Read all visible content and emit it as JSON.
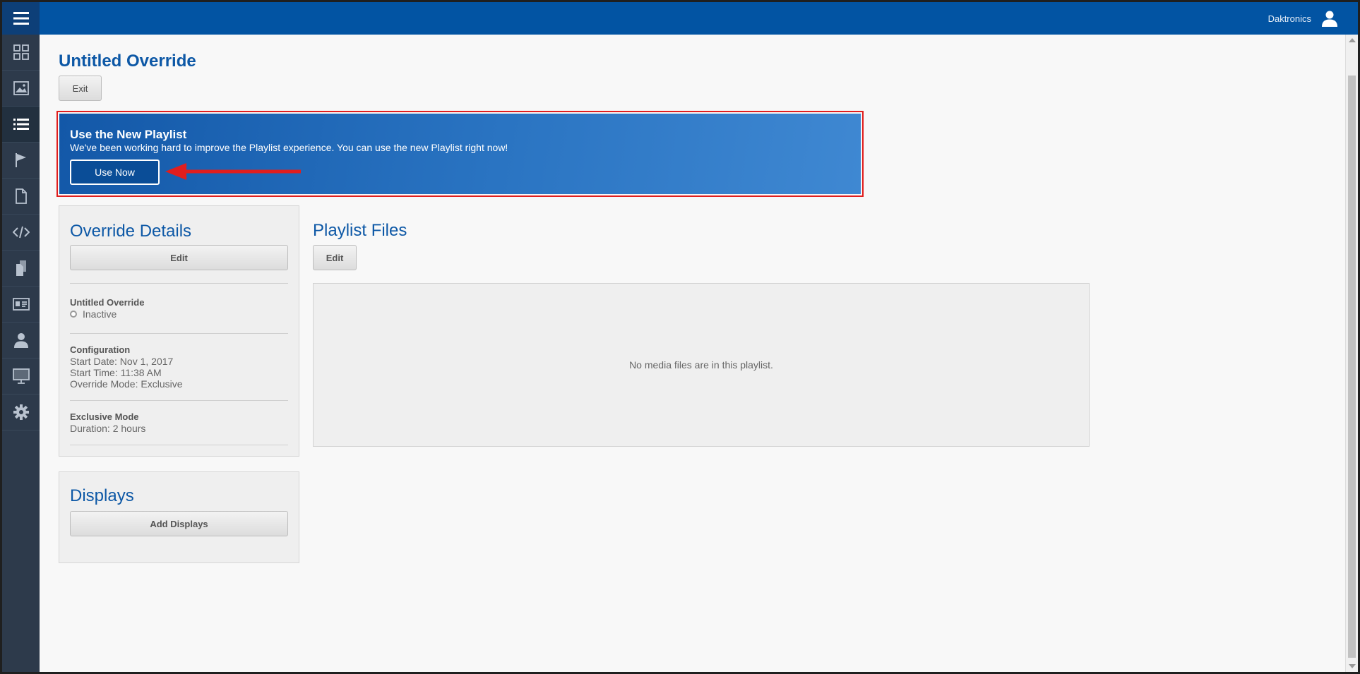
{
  "header": {
    "user_name": "Daktronics"
  },
  "sidebar": {
    "items": [
      {
        "icon": "dashboard-icon"
      },
      {
        "icon": "image-icon"
      },
      {
        "icon": "list-icon",
        "active": true
      },
      {
        "icon": "flag-icon"
      },
      {
        "icon": "document-icon"
      },
      {
        "icon": "code-icon"
      },
      {
        "icon": "files-icon"
      },
      {
        "icon": "id-card-icon"
      },
      {
        "icon": "user-icon"
      },
      {
        "icon": "monitor-icon"
      },
      {
        "icon": "gear-icon"
      }
    ]
  },
  "page": {
    "title": "Untitled Override",
    "exit_label": "Exit"
  },
  "banner": {
    "title": "Use the New Playlist",
    "text": "We've been working hard to improve the Playlist experience. You can use the new Playlist right now!",
    "button_label": "Use Now"
  },
  "details": {
    "title": "Override Details",
    "edit_label": "Edit",
    "name": "Untitled Override",
    "status": "Inactive",
    "config_label": "Configuration",
    "start_date": "Start Date: Nov 1, 2017",
    "start_time": "Start Time: 11:38 AM",
    "mode": "Override Mode: Exclusive",
    "exclusive_label": "Exclusive Mode",
    "duration": "Duration: 2 hours"
  },
  "displays": {
    "title": "Displays",
    "add_label": "Add Displays"
  },
  "playlist": {
    "title": "Playlist Files",
    "edit_label": "Edit",
    "empty_text": "No media files are in this playlist."
  },
  "colors": {
    "brand": "#0254a3",
    "sidebar": "#2d3a4b",
    "highlight": "#e01e1e"
  }
}
